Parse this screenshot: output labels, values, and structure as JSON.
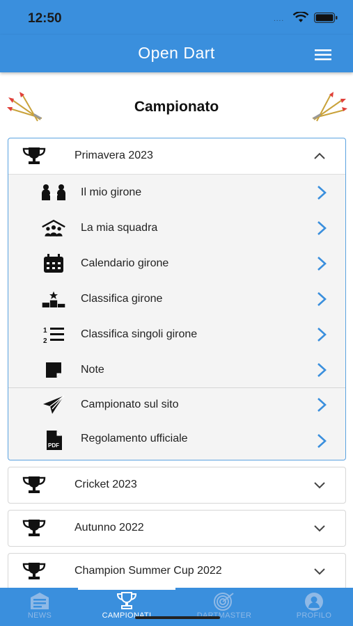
{
  "status_bar": {
    "time": "12:50",
    "signal_dots": "...."
  },
  "header": {
    "title": "Open Dart"
  },
  "page": {
    "heading": "Campionato"
  },
  "accordion": [
    {
      "title": "Primavera 2023",
      "expanded": true,
      "items": [
        {
          "label": "Il mio girone",
          "icon": "players-vs-icon"
        },
        {
          "label": "La mia squadra",
          "icon": "team-icon"
        },
        {
          "label": "Calendario girone",
          "icon": "calendar-icon"
        },
        {
          "label": "Classifica girone",
          "icon": "podium-icon"
        },
        {
          "label": "Classifica singoli girone",
          "icon": "ordered-list-icon"
        },
        {
          "label": "Note",
          "icon": "sticky-note-icon"
        }
      ],
      "extra_items": [
        {
          "label": "Campionato sul sito",
          "icon": "paper-plane-icon"
        },
        {
          "label": "Regolamento ufficiale",
          "icon": "pdf-file-icon"
        }
      ]
    },
    {
      "title": "Cricket 2023",
      "expanded": false
    },
    {
      "title": "Autunno 2022",
      "expanded": false
    },
    {
      "title": "Champion Summer Cup 2022",
      "expanded": false
    }
  ],
  "tabbar": {
    "tabs": [
      {
        "label": "NEWS",
        "icon": "newspaper-icon",
        "active": false
      },
      {
        "label": "CAMPIONATI",
        "icon": "trophy-icon",
        "active": true
      },
      {
        "label": "DARTMASTER",
        "icon": "dartboard-icon",
        "active": false
      },
      {
        "label": "PROFILO",
        "icon": "user-icon",
        "active": false
      }
    ]
  },
  "colors": {
    "primary": "#3a8fdd",
    "chevron_blue": "#3a8fdd",
    "panel_bg": "#f4f4f4"
  }
}
